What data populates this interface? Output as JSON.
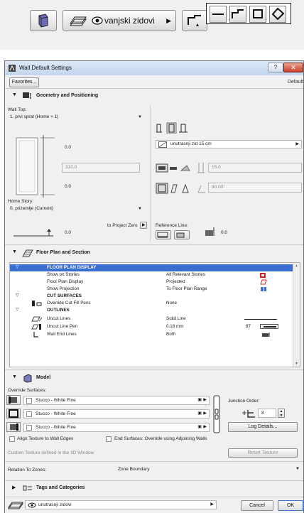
{
  "toolbar": {
    "wall_selector_label": "vanjski zidovi"
  },
  "dialog": {
    "title": "Wall Default Settings",
    "favorites_label": "Favorites...",
    "default_label": "Default"
  },
  "geometry": {
    "section_title": "Geometry and Positioning",
    "wall_top_label": "Wall Top:",
    "wall_top_value": "1. prvi sprat (Home + 1)",
    "top_offset": "0.0",
    "height_value": "310.0",
    "bottom_offset": "0.0",
    "home_story_label": "Home Story:",
    "home_story_value": "0. prizemlje (Current)",
    "to_project_zero_label": "to Project Zero",
    "project_zero_value": "0.0",
    "composite_value": "unutrasnji zid 15 cm",
    "thickness_value": "15.0",
    "angle_value": "90.00°",
    "reference_line_label": "Reference Line:",
    "reference_offset_value": "0.0"
  },
  "floorplan": {
    "section_title": "Floor Plan and Section",
    "rows": [
      {
        "type": "group",
        "label": "FLOOR PLAN DISPLAY",
        "selected": true
      },
      {
        "type": "item",
        "label": "Show on Stories",
        "value": "All Relevant Stories"
      },
      {
        "type": "item",
        "label": "Floor Plan Display",
        "value": "Projected"
      },
      {
        "type": "item",
        "label": "Show Projection",
        "value": "To Floor Plan Range"
      },
      {
        "type": "group",
        "label": "CUT SURFACES"
      },
      {
        "type": "item",
        "label": "Override Cut Fill Pens",
        "value": "None"
      },
      {
        "type": "group",
        "label": "OUTLINES"
      },
      {
        "type": "item",
        "label": "Uncut Lines",
        "value": "Solid Line"
      },
      {
        "type": "item",
        "label": "Uncut Line Pen",
        "value": "0.18 mm",
        "extra": "87"
      },
      {
        "type": "item",
        "label": "Wall End Lines",
        "value": "Both"
      }
    ]
  },
  "model": {
    "section_title": "Model",
    "override_surfaces_label": "Override Surfaces:",
    "surfaces": [
      "Stucco - White Fine",
      "Stucco - White Fine",
      "Stucco - White Fine"
    ],
    "junction_order_label": "Junction Order:",
    "junction_value": "8",
    "log_details_label": "Log Details...",
    "align_texture_label": "Align Texture to Wall Edges",
    "end_surfaces_label": "End Surfaces: Override using Adjoining Walls",
    "custom_texture_label": "Custom Texture defined in the 3D Window",
    "reset_texture_label": "Reset Texture",
    "relation_to_zones_label": "Relation To Zones:",
    "relation_to_zones_value": "Zone Boundary"
  },
  "tags": {
    "section_title": "Tags and Categories"
  },
  "footer": {
    "layer_value": "unutrasnji zidovi",
    "cancel_label": "Cancel",
    "ok_label": "OK"
  }
}
